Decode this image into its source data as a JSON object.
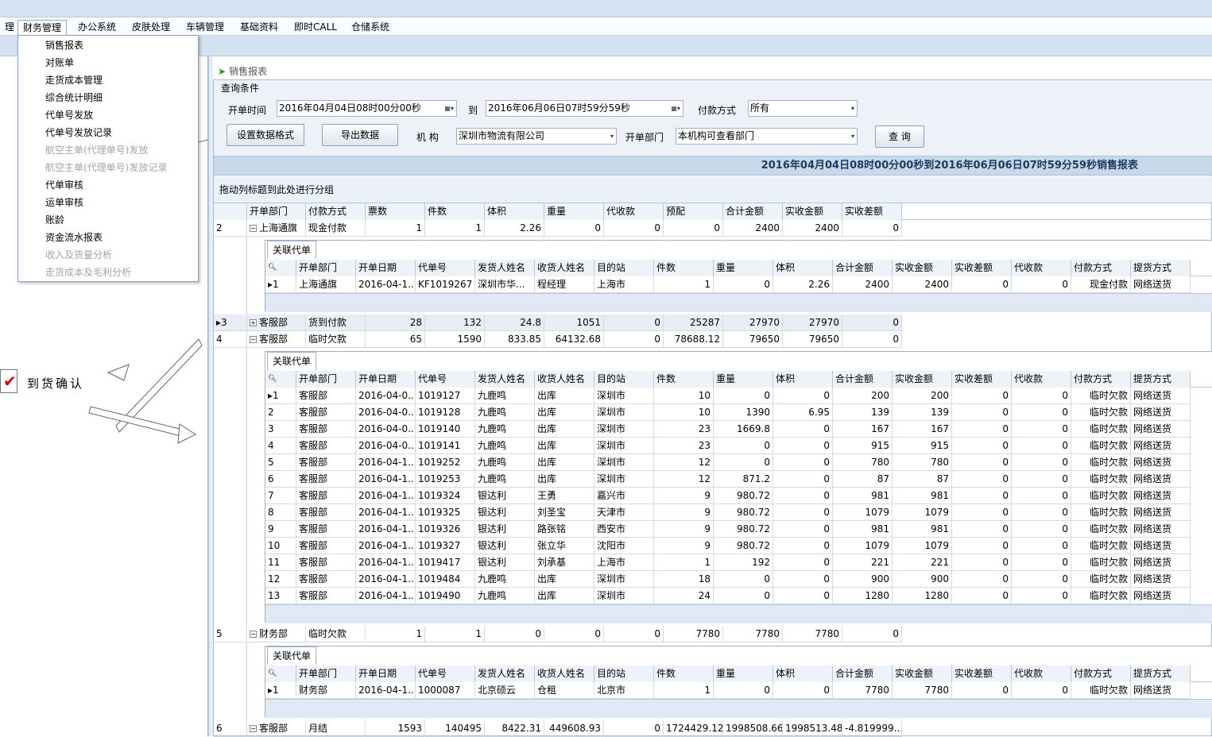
{
  "menubar": {
    "items": [
      "理",
      "财务管理",
      "办公系统",
      "皮肤处理",
      "车辆管理",
      "基础资料",
      "即时CALL",
      "仓储系统"
    ]
  },
  "dropdown": {
    "items": [
      {
        "label": "销售报表",
        "enabled": true
      },
      {
        "label": "对账单",
        "enabled": true
      },
      {
        "label": "走货成本管理",
        "enabled": true
      },
      {
        "label": "综合统计明细",
        "enabled": true
      },
      {
        "label": "代单号发放",
        "enabled": true
      },
      {
        "label": "代单号发放记录",
        "enabled": true
      },
      {
        "label": "航空主单(代理单号)发放",
        "enabled": false
      },
      {
        "label": "航空主单(代理单号)发放记录",
        "enabled": false
      },
      {
        "label": "代单审核",
        "enabled": true
      },
      {
        "label": "运单审核",
        "enabled": true
      },
      {
        "label": "账龄",
        "enabled": true
      },
      {
        "label": "资金流水报表",
        "enabled": true
      },
      {
        "label": "收入及货量分析",
        "enabled": false
      },
      {
        "label": "走货成本及毛利分析",
        "enabled": false
      }
    ]
  },
  "flow": {
    "arrive_label": "到货确认"
  },
  "tab": {
    "title": "销售报表"
  },
  "query": {
    "group_title": "查询条件",
    "start_label": "开单时间",
    "start_value": "2016年04月04日08时00分00秒",
    "to_label": "到",
    "end_value": "2016年06月06日07时59分59秒",
    "pay_label": "付款方式",
    "pay_value": "所有",
    "format_button": "设置数据格式",
    "export_button": "导出数据",
    "org_label": "机 构",
    "org_value": "深圳市物流有限公司",
    "dept_label": "开单部门",
    "dept_value": "本机构可查看部门",
    "search_button": "查 询"
  },
  "report_title": "2016年04月04日08时00分00秒到2016年06月06日07时59分59秒销售报表",
  "group_hint": "拖动列标题到此处进行分组",
  "main_columns": [
    "开单部门",
    "付款方式",
    "票数",
    "件数",
    "体积",
    "重量",
    "代收款",
    "预配",
    "合计金额",
    "实收金额",
    "实收差额"
  ],
  "detail_tab": "关联代单",
  "detail_columns": [
    "开单部门",
    "开单日期",
    "代单号",
    "发货人姓名",
    "收货人姓名",
    "目的站",
    "件数",
    "重量",
    "体积",
    "合计金额",
    "实收金额",
    "实收差额",
    "代收款",
    "付款方式",
    "提货方式"
  ],
  "groups": [
    {
      "no": "2",
      "cells": [
        "上海通旗",
        "现金付款",
        "1",
        "1",
        "2.26",
        "0",
        "0",
        "0",
        "2400",
        "2400",
        "0"
      ],
      "expanded": true,
      "details": [
        [
          "1",
          "上海通旗",
          "2016-04-1...",
          "KF1019267",
          "深圳市华...",
          "程经理",
          "上海市",
          "1",
          "0",
          "2.26",
          "2400",
          "2400",
          "0",
          "0",
          "现金付款",
          "网络送货"
        ]
      ]
    },
    {
      "no": "3",
      "cells": [
        "客服部",
        "货到付款",
        "28",
        "132",
        "24.8",
        "1051",
        "0",
        "25287",
        "27970",
        "27970",
        "0"
      ],
      "expanded": false,
      "details": []
    },
    {
      "no": "4",
      "cells": [
        "客服部",
        "临时欠款",
        "65",
        "1590",
        "833.85",
        "64132.68",
        "0",
        "78688.12",
        "79650",
        "79650",
        "0"
      ],
      "expanded": true,
      "details": [
        [
          "1",
          "客服部",
          "2016-04-0...",
          "1019127",
          "九鹿鸣",
          "出库",
          "深圳市",
          "10",
          "0",
          "0",
          "200",
          "200",
          "0",
          "0",
          "临时欠款",
          "网络送货"
        ],
        [
          "2",
          "客服部",
          "2016-04-0...",
          "1019128",
          "九鹿鸣",
          "出库",
          "深圳市",
          "10",
          "1390",
          "6.95",
          "139",
          "139",
          "0",
          "0",
          "临时欠款",
          "网络送货"
        ],
        [
          "3",
          "客服部",
          "2016-04-0...",
          "1019140",
          "九鹿鸣",
          "出库",
          "深圳市",
          "23",
          "1669.8",
          "0",
          "167",
          "167",
          "0",
          "0",
          "临时欠款",
          "网络送货"
        ],
        [
          "4",
          "客服部",
          "2016-04-0...",
          "1019141",
          "九鹿鸣",
          "出库",
          "深圳市",
          "23",
          "0",
          "0",
          "915",
          "915",
          "0",
          "0",
          "临时欠款",
          "网络送货"
        ],
        [
          "5",
          "客服部",
          "2016-04-1...",
          "1019252",
          "九鹿鸣",
          "出库",
          "深圳市",
          "12",
          "0",
          "0",
          "780",
          "780",
          "0",
          "0",
          "临时欠款",
          "网络送货"
        ],
        [
          "6",
          "客服部",
          "2016-04-1...",
          "1019253",
          "九鹿鸣",
          "出库",
          "深圳市",
          "12",
          "871.2",
          "0",
          "87",
          "87",
          "0",
          "0",
          "临时欠款",
          "网络送货"
        ],
        [
          "7",
          "客服部",
          "2016-04-1...",
          "1019324",
          "银达利",
          "王勇",
          "嘉兴市",
          "9",
          "980.72",
          "0",
          "981",
          "981",
          "0",
          "0",
          "临时欠款",
          "网络送货"
        ],
        [
          "8",
          "客服部",
          "2016-04-1...",
          "1019325",
          "银达利",
          "刘圣宝",
          "天津市",
          "9",
          "980.72",
          "0",
          "1079",
          "1079",
          "0",
          "0",
          "临时欠款",
          "网络送货"
        ],
        [
          "9",
          "客服部",
          "2016-04-1...",
          "1019326",
          "银达利",
          "路张铭",
          "西安市",
          "9",
          "980.72",
          "0",
          "981",
          "981",
          "0",
          "0",
          "临时欠款",
          "网络送货"
        ],
        [
          "10",
          "客服部",
          "2016-04-1...",
          "1019327",
          "银达利",
          "张立华",
          "沈阳市",
          "9",
          "980.72",
          "0",
          "1079",
          "1079",
          "0",
          "0",
          "临时欠款",
          "网络送货"
        ],
        [
          "11",
          "客服部",
          "2016-04-1...",
          "1019417",
          "银达利",
          "刘承基",
          "上海市",
          "1",
          "192",
          "0",
          "221",
          "221",
          "0",
          "0",
          "临时欠款",
          "网络送货"
        ],
        [
          "12",
          "客服部",
          "2016-04-1...",
          "1019484",
          "九鹿鸣",
          "出库",
          "深圳市",
          "18",
          "0",
          "0",
          "900",
          "900",
          "0",
          "0",
          "临时欠款",
          "网络送货"
        ],
        [
          "13",
          "客服部",
          "2016-04-1...",
          "1019490",
          "九鹿鸣",
          "出库",
          "深圳市",
          "24",
          "0",
          "0",
          "1280",
          "1280",
          "0",
          "0",
          "临时欠款",
          "网络送货"
        ]
      ]
    },
    {
      "no": "5",
      "cells": [
        "财务部",
        "临时欠款",
        "1",
        "1",
        "0",
        "0",
        "0",
        "7780",
        "7780",
        "7780",
        "0"
      ],
      "expanded": true,
      "details": [
        [
          "1",
          "财务部",
          "2016-04-1...",
          "1000087",
          "北京硕云",
          "仓租",
          "北京市",
          "1",
          "0",
          "0",
          "7780",
          "7780",
          "0",
          "0",
          "临时欠款",
          "网络送货"
        ]
      ]
    },
    {
      "no": "6",
      "cells": [
        "客服部",
        "月结",
        "1593",
        "140495",
        "8422.31",
        "449608.93",
        "0",
        "1724429.12",
        "1998508.66",
        "1998513.48",
        "-4.819999..."
      ],
      "expanded": true,
      "details": []
    }
  ]
}
